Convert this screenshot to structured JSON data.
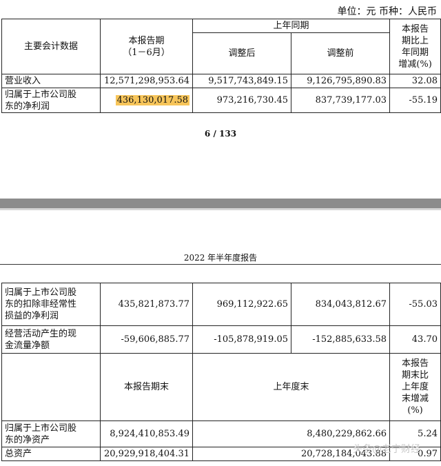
{
  "unit_line": "单位：元  币种：人民币",
  "page_number": "6 / 133",
  "report_header": "2022 年半年度报告",
  "watermark": "头条@老宁财经",
  "table1": {
    "h_item": "主要会计数据",
    "h_current": "本报告期\n（1－6月）",
    "h_prior": "上年同期",
    "h_adjusted_after": "调整后",
    "h_adjusted_before": "调整前",
    "h_change": "本报告\n期比上\n年同期\n增减(%)",
    "rows": [
      {
        "label": "营业收入",
        "current": "12,571,298,953.64",
        "after": "9,517,743,849.15",
        "before": "9,126,795,890.83",
        "change": "32.08"
      },
      {
        "label": "归属于上市公司股\n东的净利润",
        "current": "436,130,017.58",
        "after": "973,216,730.45",
        "before": "837,739,177.03",
        "change": "-55.19"
      }
    ]
  },
  "table2": {
    "rows": [
      {
        "label": "归属于上市公司股\n东的扣除非经常性\n损益的净利润",
        "current": "435,821,873.77",
        "after": "969,112,922.65",
        "before": "834,043,812.67",
        "change": "-55.03"
      },
      {
        "label": "经营活动产生的现\n金流量净额",
        "current": "-59,606,885.77",
        "after": "-105,878,919.05",
        "before": "-152,885,633.58",
        "change": "43.70"
      }
    ],
    "h_period_end": "本报告期末",
    "h_prior_year_end": "上年度末",
    "h_change_end": "本报告\n期末比\n上年度\n末增减\n(%)",
    "rows_end": [
      {
        "label": "归属于上市公司股\n东的净资产",
        "current": "8,924,410,853.49",
        "prior": "8,480,229,862.66",
        "change": "5.24"
      },
      {
        "label": "总资产",
        "current": "20,929,918,404.31",
        "prior": "20,728,184,043.88",
        "change": "0.97"
      }
    ]
  },
  "colors": {
    "highlight": "#f7c55a",
    "band": "#8c8c8c"
  }
}
